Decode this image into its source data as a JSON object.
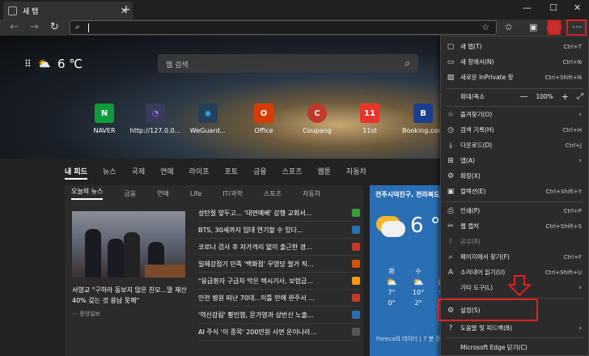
{
  "tab": {
    "title": "새 탭"
  },
  "search": {
    "placeholder": "웹 검색"
  },
  "weather": {
    "temp": "6 ℃"
  },
  "tiles": [
    {
      "label": "NAVER",
      "glyph": "N",
      "color": "#0f9d3b"
    },
    {
      "label": "http://127.0.0...",
      "glyph": "◔",
      "color": "#6f5bd6"
    },
    {
      "label": "WeGuard...",
      "glyph": "◉",
      "color": "#1a8fd0"
    },
    {
      "label": "Office",
      "glyph": "O",
      "color": "#d83b01"
    },
    {
      "label": "Coupang",
      "glyph": "C",
      "color": "#c0392b"
    },
    {
      "label": "11st",
      "glyph": "11",
      "color": "#e8352a"
    },
    {
      "label": "Booking.com",
      "glyph": "B",
      "color": "#1b3f8f"
    }
  ],
  "feed_tabs": [
    "내 피드",
    "뉴스",
    "국제",
    "연예",
    "라이프",
    "포토",
    "금융",
    "스포츠",
    "웹툰",
    "자동차"
  ],
  "news_tabs": [
    "오늘의 뉴스",
    "금융",
    "연예",
    "Life",
    "IT/과학",
    "스포츠",
    "자동차"
  ],
  "main_story": {
    "headline": "서영교 \"구하라 동보지 않은 친모...딸 재산 40% 갖는 것 용납 못해\"",
    "source": "중앙일보"
  },
  "news_items": [
    {
      "text": "성탄절 앞두고... '대면예배' 강행 교회서...",
      "color": "#3f9b3f"
    },
    {
      "text": "BTS, 30세까지 입대 연기할 수 있다...",
      "color": "#2a6fb4"
    },
    {
      "text": "코로나 검사 후 자가격리 없이 출근한 경...",
      "color": "#c0392b"
    },
    {
      "text": "일제강점기 민족 '백화점' 무영당 철거 직...",
      "color": "#d35400"
    },
    {
      "text": "\"응급환자 구급차 막은 택시기사, 보험금...",
      "color": "#f39c12"
    },
    {
      "text": "인천 병원 떠난 70대...이틀 만에 완주서 ...",
      "color": "#c0392b"
    },
    {
      "text": "'역신강림' 황인엽, 문가영과 상반신 노출...",
      "color": "#2a6fb4"
    },
    {
      "text": "AI 주식 '이 종목' 200만원 사면 운이나라...",
      "color": "#555555"
    }
  ],
  "weather_card": {
    "title": "전주시덕진구, 전라북도",
    "temp": "6 °",
    "days": [
      {
        "day": "화",
        "hi": "7°",
        "lo": "0°"
      },
      {
        "day": "수",
        "hi": "10°",
        "lo": "2°"
      },
      {
        "day": "목",
        "hi": "9°",
        "lo": "3°"
      }
    ],
    "footer": "Foreca의 데이터 | 7 분 전"
  },
  "menu": {
    "items": [
      {
        "icon": "▢",
        "label": "새 탭(T)",
        "shortcut": "Ctrl+T"
      },
      {
        "icon": "▭",
        "label": "새 창에서(N)",
        "shortcut": "Ctrl+N"
      },
      {
        "icon": "▨",
        "label": "새로운 InPrivate 창",
        "shortcut": "Ctrl+Shift+N"
      },
      {
        "icon": "☆",
        "label": "즐겨찾기(O)",
        "shortcut": "›"
      },
      {
        "icon": "◷",
        "label": "검색 기록(H)",
        "shortcut": "Ctrl+H"
      },
      {
        "icon": "⤓",
        "label": "다운로드(D)",
        "shortcut": "Ctrl+J"
      },
      {
        "icon": "⊞",
        "label": "앱(A)",
        "shortcut": "›"
      },
      {
        "icon": "⚙",
        "label": "확장(X)",
        "shortcut": ""
      },
      {
        "icon": "▣",
        "label": "컬렉션(E)",
        "shortcut": "Ctrl+Shift+Y"
      },
      {
        "icon": "⎙",
        "label": "인쇄(P)",
        "shortcut": "Ctrl+P"
      },
      {
        "icon": "✂",
        "label": "웹 캡처",
        "shortcut": "Ctrl+Shift+S"
      },
      {
        "icon": "⇪",
        "label": "공유(R)",
        "shortcut": ""
      },
      {
        "icon": "⌕",
        "label": "페이지에서 찾기(F)",
        "shortcut": "Ctrl+F"
      },
      {
        "icon": "A",
        "label": "소리내어 읽기(U)",
        "shortcut": "Ctrl+Shift+U"
      },
      {
        "icon": "",
        "label": "기타 도구(L)",
        "shortcut": "›"
      },
      {
        "icon": "⚙",
        "label": "설정(S)",
        "shortcut": ""
      },
      {
        "icon": "?",
        "label": "도움말 및 피드백(B)",
        "shortcut": "›"
      },
      {
        "icon": "",
        "label": "Microsoft Edge 닫기(C)",
        "shortcut": ""
      }
    ],
    "zoom": {
      "label": "확대/축소",
      "value": "100%"
    }
  }
}
